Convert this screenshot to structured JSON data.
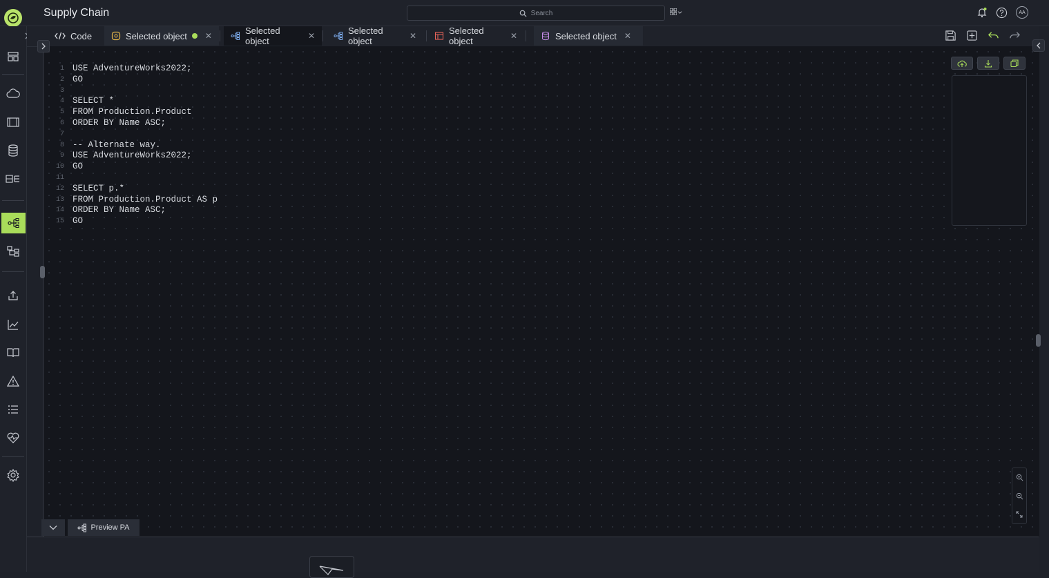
{
  "app": {
    "title": "Supply Chain",
    "logo_icon": "leaf-logo-icon"
  },
  "search": {
    "placeholder": "Search"
  },
  "header_right": {
    "avatar_initials": "AA",
    "icons": [
      "bell-icon",
      "help-icon"
    ]
  },
  "tabs": [
    {
      "label": "Code",
      "icon": "code-icon"
    },
    {
      "label": "Selected object",
      "icon": "object-icon",
      "modified": true
    },
    {
      "label": "Selected object",
      "icon": "hierarchy-icon",
      "active": true
    },
    {
      "label": "Selected object",
      "icon": "hierarchy-icon"
    },
    {
      "label": "Selected object",
      "icon": "table-icon"
    },
    {
      "label": "Selected object",
      "icon": "database-icon"
    }
  ],
  "code_lines": [
    {
      "num": "1",
      "text": "USE AdventureWorks2022;"
    },
    {
      "num": "2",
      "text": "GO"
    },
    {
      "num": "3",
      "text": ""
    },
    {
      "num": "4",
      "text": "SELECT *"
    },
    {
      "num": "5",
      "text": "FROM Production.Product"
    },
    {
      "num": "6",
      "text": "ORDER BY Name ASC;"
    },
    {
      "num": "7",
      "text": ""
    },
    {
      "num": "8",
      "text": "-- Alternate way."
    },
    {
      "num": "9",
      "text": "USE AdventureWorks2022;"
    },
    {
      "num": "10",
      "text": "GO"
    },
    {
      "num": "11",
      "text": ""
    },
    {
      "num": "12",
      "text": "SELECT p.*"
    },
    {
      "num": "13",
      "text": "FROM Production.Product AS p"
    },
    {
      "num": "14",
      "text": "ORDER BY Name ASC;"
    },
    {
      "num": "15",
      "text": "GO"
    }
  ],
  "bottom": {
    "preview_label": "Preview PA"
  },
  "colors": {
    "accent": "#a9dc5a",
    "background": "#14161c",
    "panel": "#1f222a"
  }
}
